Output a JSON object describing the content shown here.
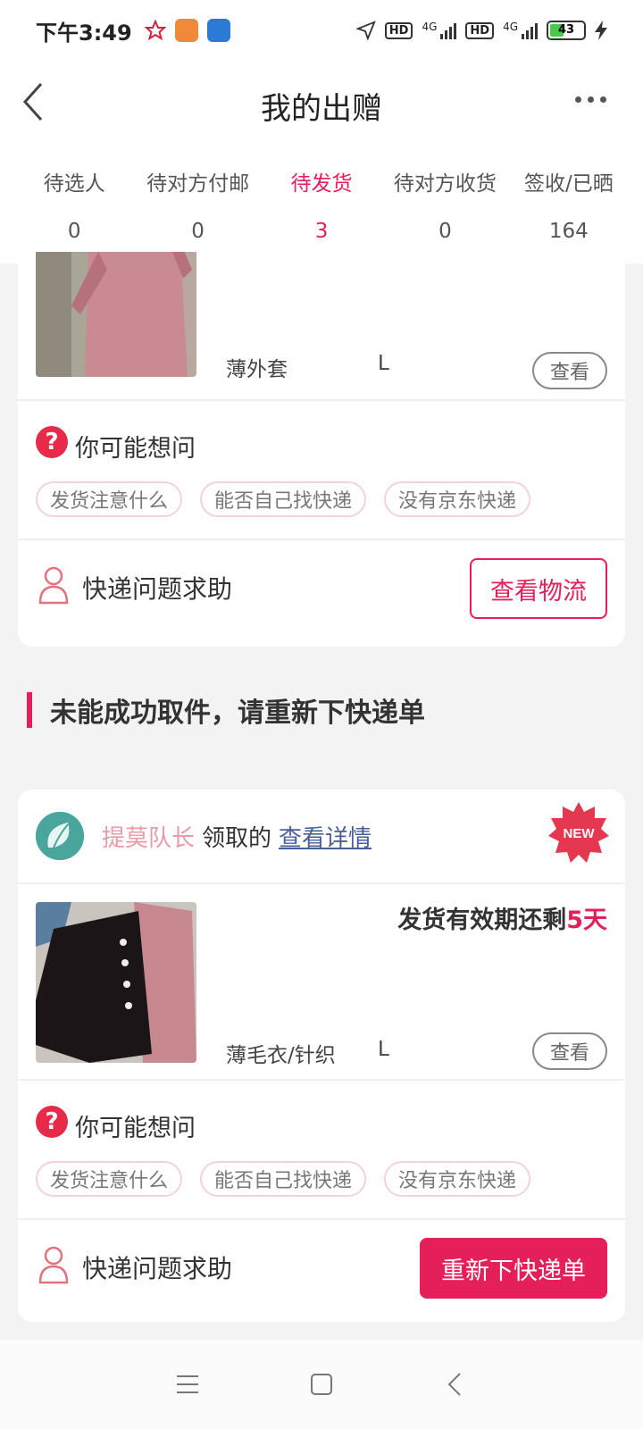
{
  "status_bar": {
    "time": "下午3:49",
    "network1": "4G",
    "network2": "4G",
    "hd1": "HD",
    "hd2": "HD",
    "battery": "43"
  },
  "header": {
    "title": "我的出赠"
  },
  "tabs": [
    {
      "label": "待选人",
      "count": "0"
    },
    {
      "label": "待对方付邮",
      "count": "0"
    },
    {
      "label": "待发货",
      "count": "3",
      "active": true
    },
    {
      "label": "待对方收货",
      "count": "0"
    },
    {
      "label": "签收/已晒",
      "count": "164"
    }
  ],
  "card1": {
    "product_type": "薄外套",
    "product_size": "L",
    "view_label": "查看",
    "faq_title": "你可能想问",
    "chips": [
      "发货注意什么",
      "能否自己找快递",
      "没有京东快递"
    ],
    "help_text": "快递问题求助",
    "action_label": "查看物流"
  },
  "section": {
    "heading": "未能成功取件，请重新下快递单"
  },
  "card2": {
    "claimer_name": "提莫队长",
    "claimer_verb": "领取的",
    "detail_link": "查看详情",
    "badge": "NEW",
    "deadline_prefix": "发货有效期还剩",
    "deadline_days": "5天",
    "product_type": "薄毛衣/针织",
    "product_size": "L",
    "view_label": "查看",
    "faq_title": "你可能想问",
    "chips": [
      "发货注意什么",
      "能否自己找快递",
      "没有京东快递"
    ],
    "help_text": "快递问题求助",
    "action_label": "重新下快递单"
  },
  "colors": {
    "accent": "#e41f59",
    "claimer_name": "#e89aa7",
    "link": "#4a5e9a"
  }
}
